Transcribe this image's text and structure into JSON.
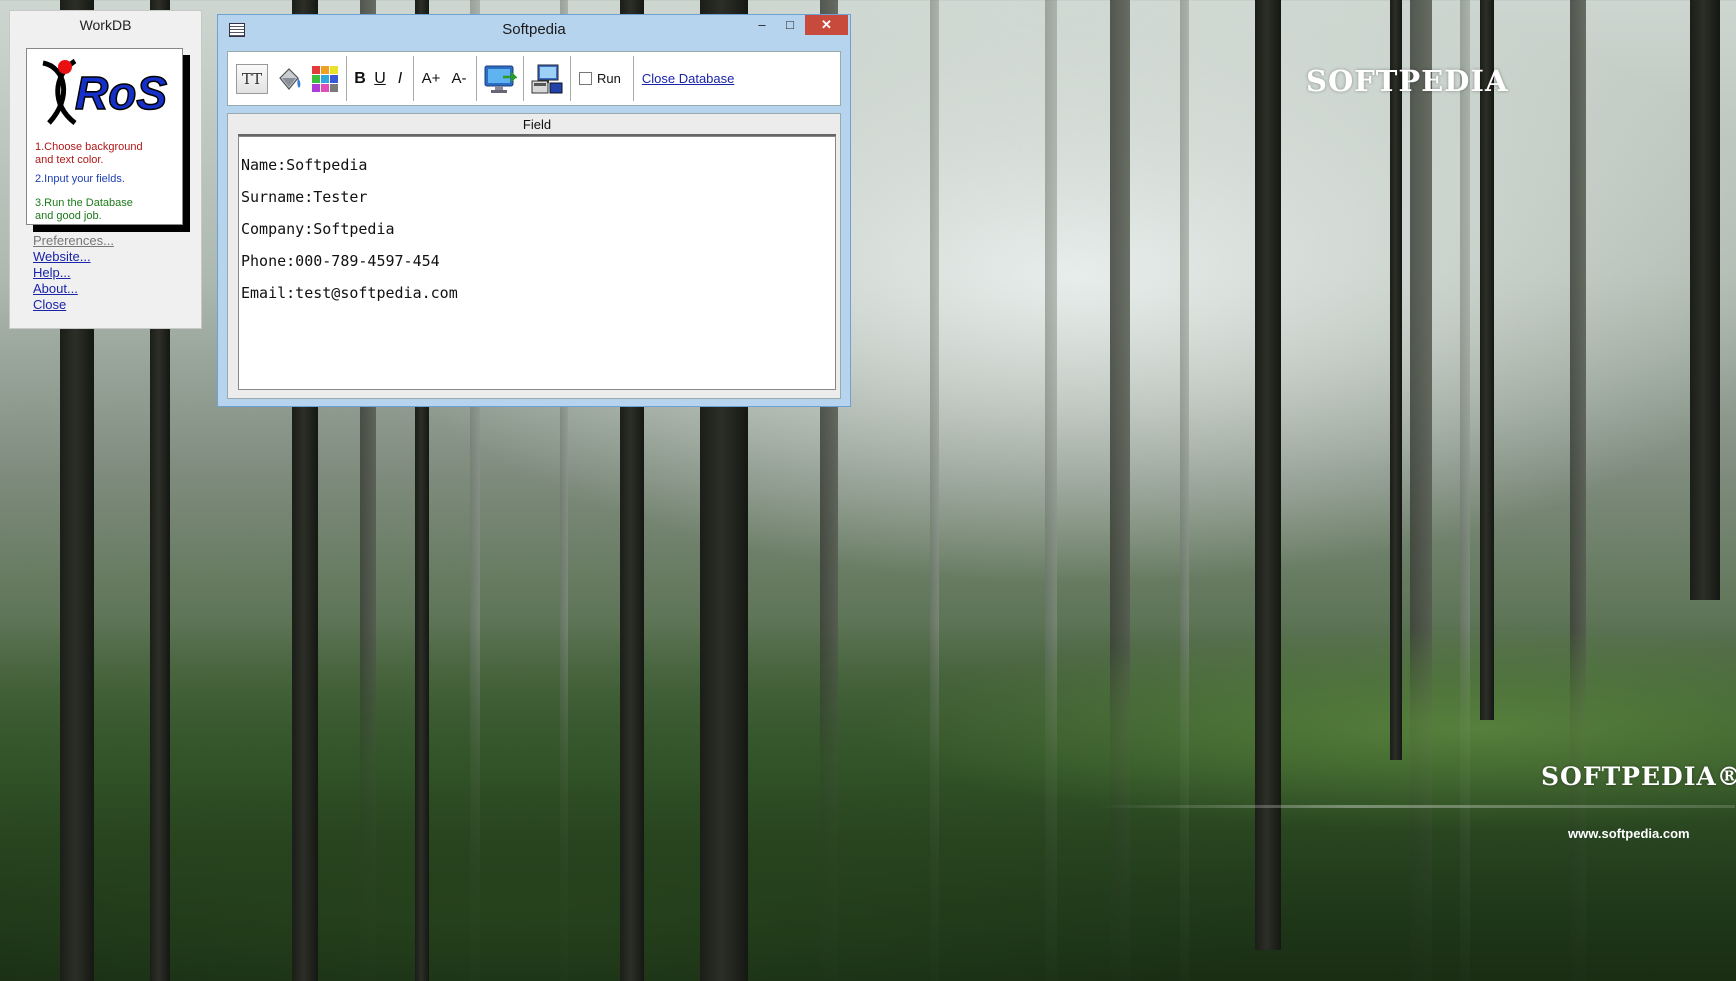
{
  "workdb": {
    "title": "WorkDB",
    "logo_text": "RoS",
    "steps": [
      "1.Choose background\nand text color.",
      "2.Input your fields.",
      "3.Run the Database\nand good job."
    ],
    "links": [
      "Preferences...",
      "Website...",
      "Help...",
      "About...",
      "Close"
    ]
  },
  "window": {
    "title": "Softpedia",
    "controls": {
      "minimize": "–",
      "maximize": "□",
      "close": "✕"
    }
  },
  "toolbar": {
    "tt_label": "TT",
    "bold_label": "B",
    "underline_label": "U",
    "italic_label": "I",
    "font_up_label": "A+",
    "font_down_label": "A-",
    "run_label": "Run",
    "run_checked": false,
    "close_db_label": "Close Database"
  },
  "field": {
    "header": "Field",
    "lines": [
      "Name:Softpedia",
      "Surname:Tester",
      "Company:Softpedia",
      "Phone:000-789-4597-454",
      "Email:test@softpedia.com"
    ]
  },
  "desktop": {
    "brand": "SOFTPEDIA",
    "brand_bottom": "SOFTPEDIA®",
    "url": "www.softpedia.com"
  },
  "icons": {
    "paint_bucket": "paint-bucket-icon",
    "color_grid": "color-palette-icon",
    "monitor": "monitor-run-icon",
    "computer": "computer-network-icon",
    "app": "table-app-icon"
  }
}
